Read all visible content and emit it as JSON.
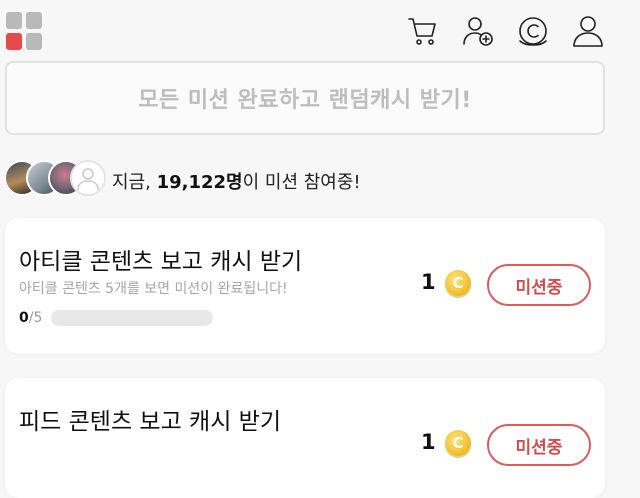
{
  "header": {
    "icons": [
      "grid-logo-icon",
      "cart-icon",
      "add-friend-icon",
      "cash-icon",
      "profile-icon"
    ]
  },
  "banner": {
    "text": "모든 미션 완료하고 랜덤캐시 받기!"
  },
  "participants": {
    "prefix": "지금, ",
    "count": "19,122명",
    "suffix": "이 미션 참여중!"
  },
  "missions": [
    {
      "title": "아티클 콘텐츠 보고 캐시 받기",
      "description": "아티클 콘텐츠 5개를 보면 미션이 완료됩니다!",
      "progress_done": "0",
      "progress_total": "/5",
      "progress_fraction": 0,
      "reward": "1",
      "coin_symbol": "C",
      "button_label": "미션중"
    },
    {
      "title": "피드 콘텐츠 보고 캐시 받기",
      "reward": "1",
      "coin_symbol": "C",
      "button_label": "미션중"
    }
  ],
  "colors": {
    "accent": "#e84a4a",
    "coin": "#f2c233",
    "banner_text": "#bdbdbd"
  }
}
